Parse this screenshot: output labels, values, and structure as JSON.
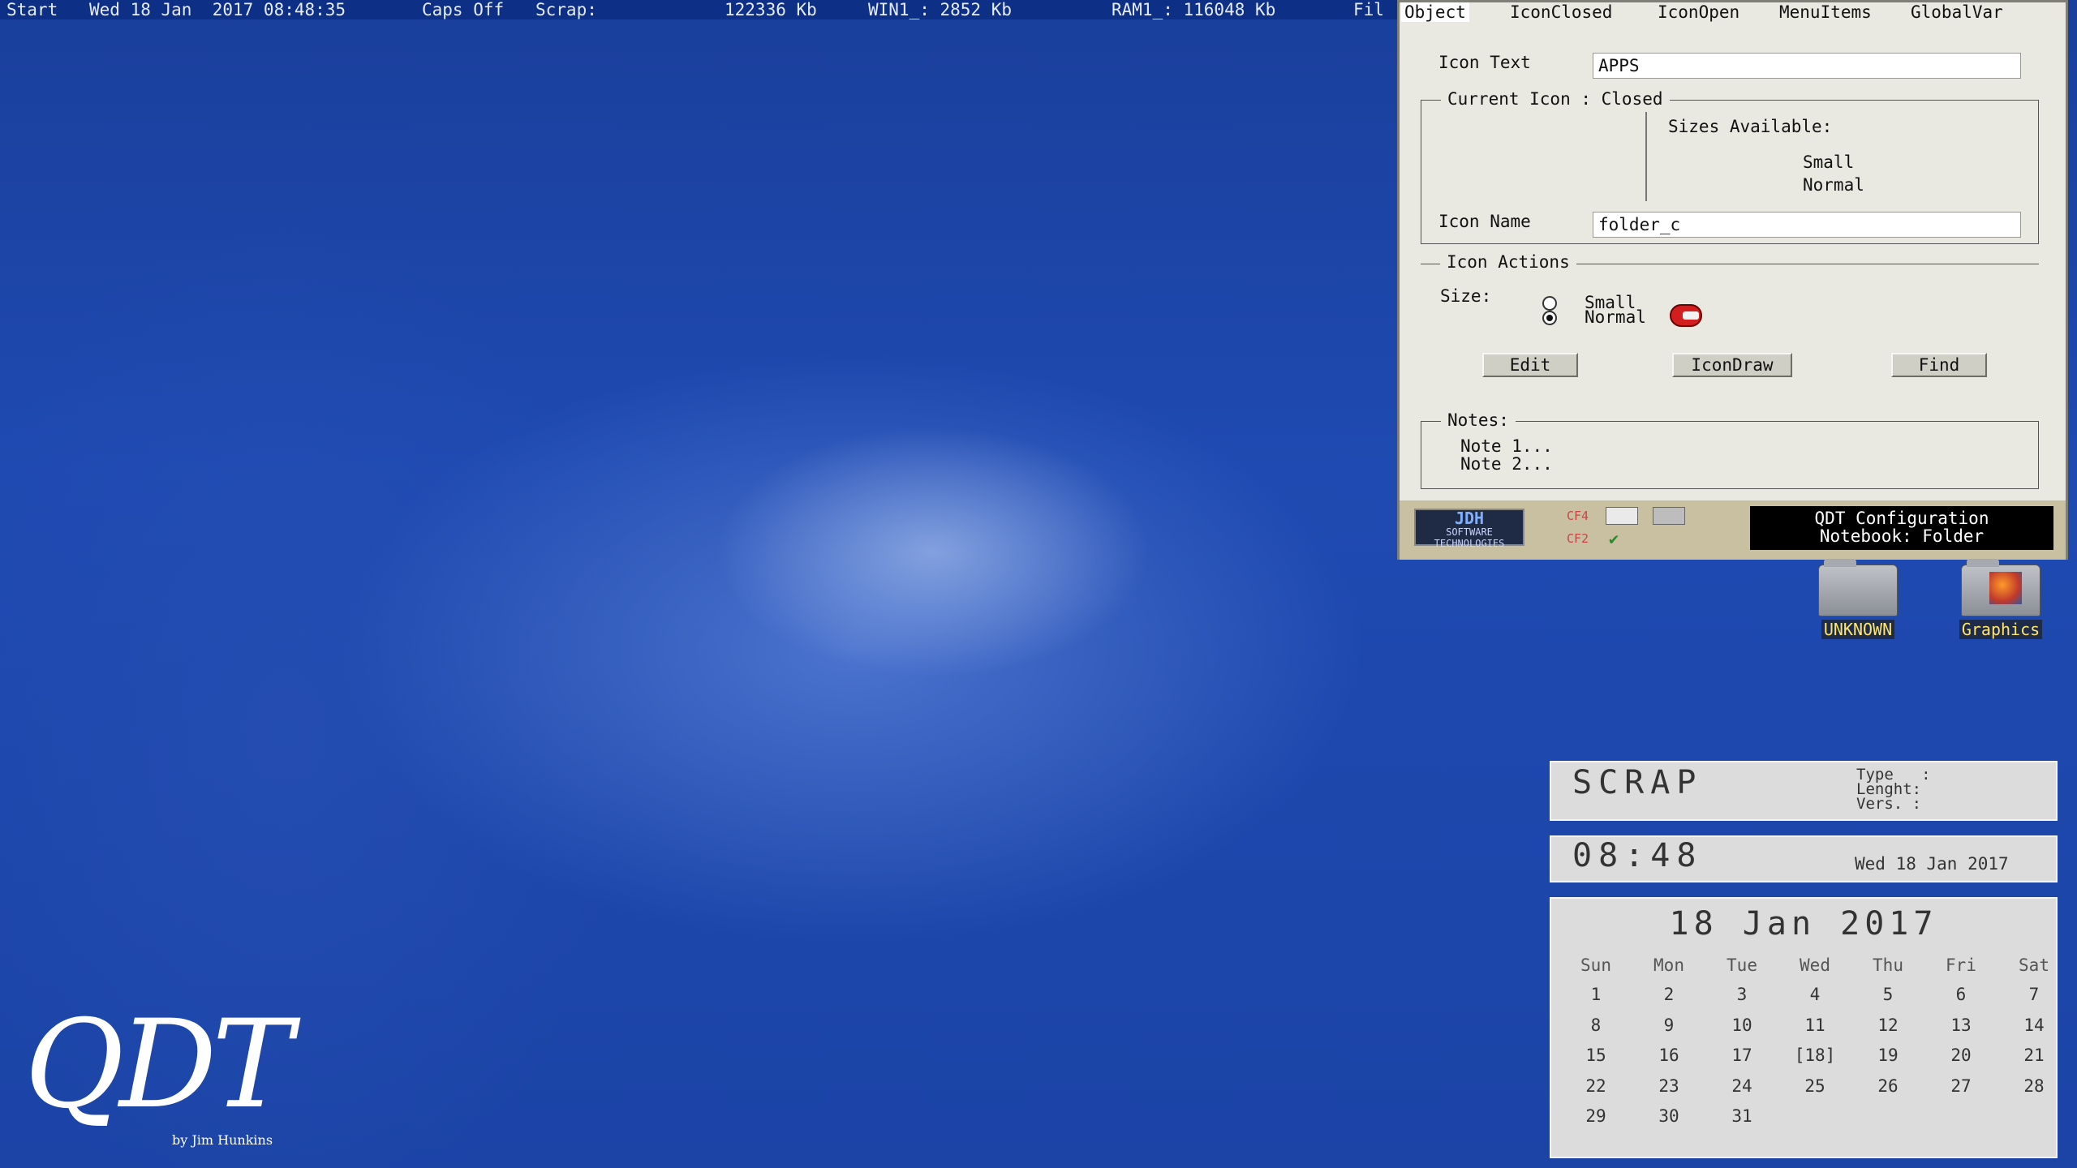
{
  "topbar": {
    "start": "Start",
    "datetime": "Wed 18 Jan  2017 08:48:35",
    "caps": "Caps Off",
    "scrap": "Scrap:",
    "mem1": "122336 Kb",
    "win1": "WIN1_: 2852 Kb",
    "ram1": "RAM1_: 116048 Kb",
    "file_stub": "Fil"
  },
  "notebook": {
    "tabs": [
      "Object",
      "IconClosed",
      "IconOpen",
      "MenuItems",
      "GlobalVar"
    ],
    "icon_text_label": "Icon Text",
    "icon_text_value": "APPS",
    "current_icon_title": "Current Icon : Closed",
    "sizes_available_label": "Sizes Available:",
    "size_small": "Small",
    "size_normal": "Normal",
    "icon_name_label": "Icon Name",
    "icon_name_value": "folder_c",
    "icon_actions_title": "Icon Actions",
    "size_label": "Size:",
    "radio_small": "Small",
    "radio_normal": "Normal",
    "radio_selected": "Normal",
    "buttons": {
      "edit": "Edit",
      "icondraw": "IconDraw",
      "find": "Find"
    },
    "notes_title": "Notes:",
    "notes": [
      "Note 1...",
      "Note 2..."
    ],
    "footer": {
      "logo_top": "JDH",
      "logo_mid": "SOFTWARE",
      "logo_bottom": "TECHNOLOGIES",
      "cf4": "CF4",
      "cf2": "CF2",
      "status_line1": "QDT  Configuration",
      "status_line2": "Notebook: Folder"
    }
  },
  "desktop_icons": [
    {
      "label": "UNKNOWN",
      "icon": "folder-icon"
    },
    {
      "label": "Graphics",
      "icon": "graphics-folder-icon"
    }
  ],
  "scrap_panel": {
    "title": "SCRAP",
    "type_label": "Type   :",
    "length_label": "Lenght:",
    "vers_label": "Vers. :"
  },
  "clock_panel": {
    "time": "08:48",
    "date": "Wed 18 Jan 2017"
  },
  "calendar": {
    "title": "18  Jan  2017",
    "weekdays": [
      "Sun",
      "Mon",
      "Tue",
      "Wed",
      "Thu",
      "Fri",
      "Sat"
    ],
    "weeks": [
      [
        "1",
        "2",
        "3",
        "4",
        "5",
        "6",
        "7"
      ],
      [
        "8",
        "9",
        "10",
        "11",
        "12",
        "13",
        "14"
      ],
      [
        "15",
        "16",
        "17",
        "[18]",
        "19",
        "20",
        "21"
      ],
      [
        "22",
        "23",
        "24",
        "25",
        "26",
        "27",
        "28"
      ],
      [
        "29",
        "30",
        "31",
        "",
        "",
        "",
        ""
      ]
    ]
  },
  "logo": {
    "text": "QDT",
    "byline": "by Jim Hunkins"
  }
}
